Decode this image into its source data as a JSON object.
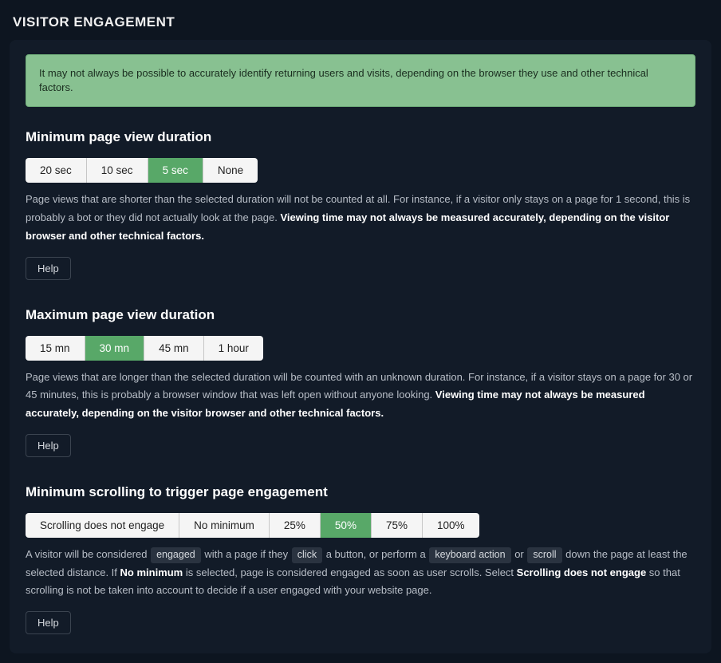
{
  "page": {
    "title": "VISITOR ENGAGEMENT"
  },
  "info_banner": "It may not always be possible to accurately identify returning users and visits, depending on the browser they use and other technical factors.",
  "min_duration": {
    "heading": "Minimum page view duration",
    "options": [
      "20 sec",
      "10 sec",
      "5 sec",
      "None"
    ],
    "selected_index": 2,
    "desc_plain": "Page views that are shorter than the selected duration will not be counted at all. For instance, if a visitor only stays on a page for 1 second, this is probably a bot or they did not actually look at the page. ",
    "desc_bold": "Viewing time may not always be measured accurately, depending on the visitor browser and other technical factors.",
    "help": "Help"
  },
  "max_duration": {
    "heading": "Maximum page view duration",
    "options": [
      "15 mn",
      "30 mn",
      "45 mn",
      "1 hour"
    ],
    "selected_index": 1,
    "desc_plain": "Page views that are longer than the selected duration will be counted with an unknown duration. For instance, if a visitor stays on a page for 30 or 45 minutes, this is probably a browser window that was left open without anyone looking. ",
    "desc_bold": "Viewing time may not always be measured accurately, depending on the visitor browser and other technical factors.",
    "help": "Help"
  },
  "min_scroll": {
    "heading": "Minimum scrolling to trigger page engagement",
    "options": [
      "Scrolling does not engage",
      "No minimum",
      "25%",
      "50%",
      "75%",
      "100%"
    ],
    "selected_index": 3,
    "desc_prefix": "A visitor will be considered ",
    "pill_engaged": "engaged",
    "desc_mid1": " with a page if they ",
    "pill_click": "click",
    "desc_mid2": " a button, or perform a ",
    "pill_keyboard": "keyboard action",
    "desc_mid3": " or ",
    "pill_scroll": "scroll",
    "desc_mid4": " down the page at least the selected distance. If ",
    "bold_no_min": "No minimum",
    "desc_mid5": " is selected, page is considered engaged as soon as user scrolls. Select ",
    "bold_not_engage": "Scrolling does not engage",
    "desc_suffix": " so that scrolling is not be taken into account to decide if a user engaged with your website page.",
    "help": "Help"
  }
}
